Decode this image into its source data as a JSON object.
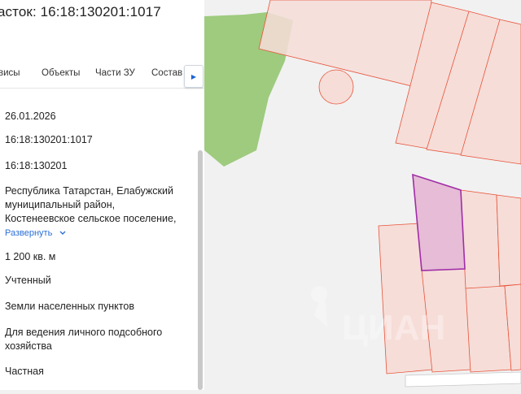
{
  "panel": {
    "title": "асток: 16:18:130201:1017",
    "tabs": [
      "висы",
      "Объекты",
      "Части ЗУ",
      "Состав"
    ],
    "tab_scroll_arrow": "chevron-right-icon",
    "rows": [
      "26.01.2026",
      "16:18:130201:1017",
      "16:18:130201",
      "Республика Татарстан, Елабужский",
      "муниципальный район,",
      "Костенеевское сельское поселение,",
      "1 200 кв. м",
      "Учтенный",
      "Земли населенных пунктов",
      "Для ведения личного подсобного",
      "хозяйства",
      "Частная"
    ],
    "expand_label": "Развернуть",
    "expand_icon": "chevron-down-icon"
  },
  "map": {
    "watermark": "ЦИАН",
    "colors": {
      "parcel_fill": "#f6ddd8",
      "parcel_stroke": "#e8533a",
      "selected_fill": "#e6bcd6",
      "selected_stroke": "#a02da6",
      "vegetation": "#9ecb7e"
    }
  }
}
